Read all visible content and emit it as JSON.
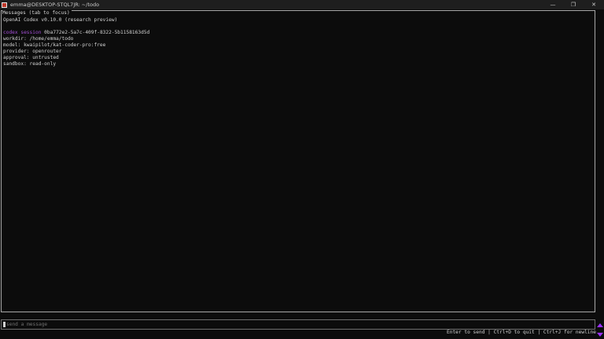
{
  "window": {
    "title": "emma@DESKTOP-STQL7JR: ~/todo",
    "controls": {
      "minimize": "—",
      "maximize": "❐",
      "close": "✕"
    }
  },
  "messages_panel": {
    "title": "Messages (tab to focus)",
    "lines": {
      "header": "OpenAI Codex v0.10.0 (research preview)",
      "session_label": "codex session",
      "session_id": "0ba772e2-5a7c-409f-8322-5b1158163d5d",
      "workdir": "workdir: /home/emma/todo",
      "model": "model: kwaipilot/kat-coder-pro:free",
      "provider": "provider: openrouter",
      "approval": "approval: untrusted",
      "sandbox": "sandbox: read-only"
    }
  },
  "input": {
    "placeholder": "send a message",
    "value": ""
  },
  "hint": "Enter to send | Ctrl+D to quit | Ctrl+J for newline",
  "colors": {
    "accent": "#a34fd6",
    "scroll_marker": "#9b30ff"
  }
}
